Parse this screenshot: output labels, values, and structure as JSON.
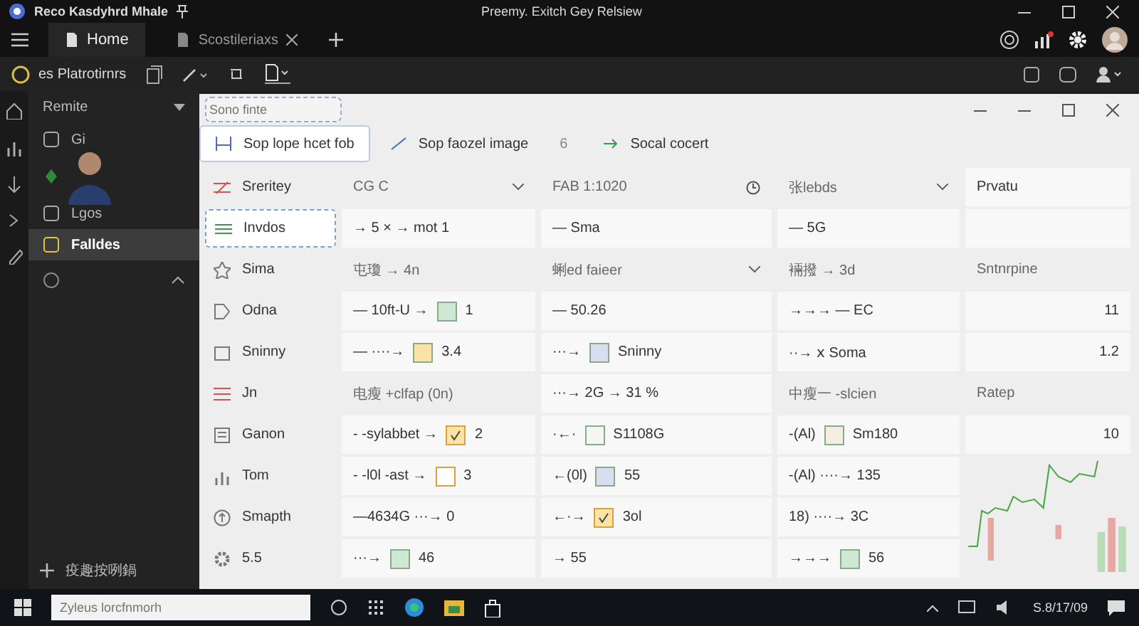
{
  "title_bar": {
    "title": "Reco Kasdyhrd Mhale",
    "center_text": "Preemy. Exitch Gey Relsiew"
  },
  "tabs": [
    {
      "label": "Home",
      "selected": true
    },
    {
      "label": "Scostileriaxs",
      "selected": false
    }
  ],
  "toolbar": {
    "label": "es Platrotirnrs"
  },
  "sidebar": {
    "header": "Remite",
    "items": [
      {
        "label": "Gi",
        "selected": false
      },
      {
        "label": "Lgos",
        "selected": false
      },
      {
        "label": "Falldes",
        "selected": true
      }
    ],
    "footer": "疫趣按咧鍋"
  },
  "panel": {
    "search": {
      "placeholder": "Sono finte"
    },
    "top_tabs": [
      {
        "label": "Sop lope hcet fob",
        "selected": true
      },
      {
        "label": "Sop faozel image",
        "count": "6",
        "selected": false
      },
      {
        "label": "Socal cocert",
        "selected": false
      }
    ],
    "rows": [
      {
        "nav": {
          "label": "Sreritey",
          "kind": "filter",
          "selected": false
        },
        "cells": [
          {
            "kind": "dropdown",
            "text": "CG C"
          },
          {
            "kind": "clock",
            "text": "FAB 1:1020"
          },
          {
            "kind": "dropdown",
            "text": "张lebds"
          },
          {
            "kind": "text",
            "text": "Prvatu"
          }
        ]
      },
      {
        "nav": {
          "label": "Invdos",
          "kind": "target",
          "selected": true
        },
        "cells": [
          {
            "kind": "text",
            "text": "→ 5  ×  → mot 1"
          },
          {
            "kind": "text",
            "text": "— Sma"
          },
          {
            "kind": "text",
            "text": "— 5G"
          },
          {
            "kind": "blank"
          }
        ]
      },
      {
        "nav": {
          "label": "Sima",
          "kind": "star",
          "selected": false
        },
        "cells": [
          {
            "kind": "header",
            "text": "屯瓊 → 4n"
          },
          {
            "kind": "dropdown",
            "text": "蜊ed faieer"
          },
          {
            "kind": "header",
            "text": "裲撥 → 3d"
          },
          {
            "kind": "header",
            "text": "Sntnrpine"
          }
        ]
      },
      {
        "nav": {
          "label": "Odna",
          "kind": "tag",
          "selected": false
        },
        "cells": [
          {
            "kind": "swatch",
            "text": "— 10ft-U →",
            "value": "1",
            "color": "#cfe8d3"
          },
          {
            "kind": "text",
            "text": "— 50.26"
          },
          {
            "kind": "text",
            "text": "→→→ — EC"
          },
          {
            "kind": "number",
            "text": "11"
          }
        ]
      },
      {
        "nav": {
          "label": "Sninny",
          "kind": "box",
          "selected": false
        },
        "cells": [
          {
            "kind": "swatch",
            "text": "— ····→",
            "value": "3.4",
            "color": "#fbe3a6"
          },
          {
            "kind": "swatch",
            "text": "···→",
            "value": "Sninny",
            "color": "#d6def0"
          },
          {
            "kind": "text",
            "text": "··→ ⅹ Soma"
          },
          {
            "kind": "number",
            "text": "1.2"
          }
        ]
      },
      {
        "nav": {
          "label": "Jn",
          "kind": "menu",
          "selected": false
        },
        "cells": [
          {
            "kind": "header",
            "text": "电瘦 +clfap (0n)"
          },
          {
            "kind": "text",
            "text": "···→ 2G  → 31 %"
          },
          {
            "kind": "header",
            "text": "中瘦一 -slcien"
          },
          {
            "kind": "header",
            "text": "Ratep"
          }
        ]
      },
      {
        "nav": {
          "label": "Ganon",
          "kind": "list",
          "selected": false
        },
        "cells": [
          {
            "kind": "check",
            "text": "- -sylabbet →",
            "value": "2",
            "checked": true
          },
          {
            "kind": "swatch",
            "text": "·←·",
            "value": "S1108G",
            "color": "#f4f6f4"
          },
          {
            "kind": "swatch",
            "text": "-(Al)",
            "value": "Sm180",
            "color": "#f6ede2"
          },
          {
            "kind": "number",
            "text": "10"
          }
        ]
      },
      {
        "nav": {
          "label": "Tom",
          "kind": "chart",
          "selected": false
        },
        "cells": [
          {
            "kind": "check",
            "text": "- -l0l -ast →",
            "value": "3",
            "checked": false
          },
          {
            "kind": "swatch",
            "text": "←(0l)",
            "value": "55",
            "color": "#d6def0"
          },
          {
            "kind": "text",
            "text": "-(Al) ····→ 135"
          },
          {
            "kind": "chart"
          }
        ]
      },
      {
        "nav": {
          "label": "Smapth",
          "kind": "upload",
          "selected": false
        },
        "cells": [
          {
            "kind": "text",
            "text": "—4634G  ···→ 0"
          },
          {
            "kind": "check",
            "text": "←·→",
            "value": "3ol",
            "checked": true
          },
          {
            "kind": "text",
            "text": "18)  ····→ 3C"
          }
        ]
      },
      {
        "nav": {
          "label": "5.5",
          "kind": "gear",
          "selected": false
        },
        "cells": [
          {
            "kind": "swatch",
            "text": "···→",
            "value": "46",
            "color": "#cfe8d3"
          },
          {
            "kind": "text",
            "text": "→ 55"
          },
          {
            "kind": "swatch",
            "text": "→→→",
            "value": "56",
            "color": "#cfe8d3"
          }
        ]
      }
    ]
  },
  "taskbar": {
    "search_placeholder": "Zyleus lorcfnmorh",
    "clock": "S.8/17/09"
  }
}
